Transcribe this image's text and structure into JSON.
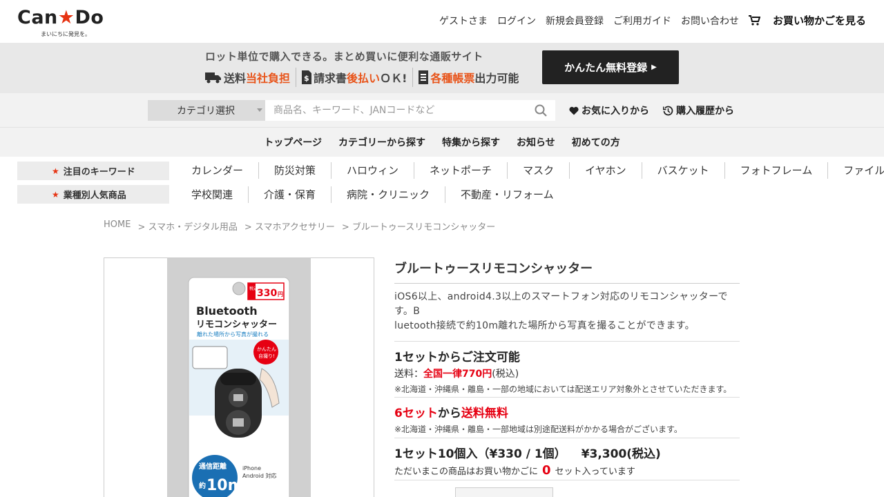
{
  "header": {
    "logo_text_a": "Can",
    "logo_star": "★",
    "logo_text_b": "Do",
    "logo_tagline": "まいにちに発見を。",
    "links": [
      "ゲストさま",
      "ログイン",
      "新規会員登録",
      "ご利用ガイド",
      "お問い合わせ"
    ],
    "cart_label": "お買い物かごを見る"
  },
  "promo": {
    "headline": "ロット単位で購入できる。まとめ買いに便利な通販サイト",
    "feat1_a": "送料",
    "feat1_b": "当社負担",
    "feat2_a": "請求書",
    "feat2_b": "後払い",
    "feat2_c": "ＯＫ!",
    "feat3_b": "各種帳票",
    "feat3_c": "出力可能",
    "register_label": "かんたん無料登録"
  },
  "search": {
    "category_label": "カテゴリ選択",
    "placeholder": "商品名、キーワード、JANコードなど",
    "favorites_label": "お気に入りから",
    "history_label": "購入履歴から"
  },
  "nav": [
    "トップページ",
    "カテゴリーから探す",
    "特集から探す",
    "お知らせ",
    "初めての方"
  ],
  "keywords": {
    "label": "注目のキーワード",
    "items": [
      "カレンダー",
      "防災対策",
      "ハロウィン",
      "ネットポーチ",
      "マスク",
      "イヤホン",
      "バスケット",
      "フォトフレーム",
      "ファイル"
    ]
  },
  "industry": {
    "label": "業種別人気商品",
    "items": [
      "学校関連",
      "介護・保育",
      "病院・クリニック",
      "不動産・リフォーム"
    ]
  },
  "breadcrumb": [
    "HOME",
    "> スマホ・デジタル用品",
    "> スマホアクセサリー",
    "> ブルートゥースリモコンシャッター"
  ],
  "product": {
    "title": "ブルートゥースリモコンシャッター",
    "desc_line1": "iOS6以上、android4.3以上のスマートフォン対応のリモコンシャッターで",
    "desc_line2": "す。B",
    "desc_line3": "luetooth接続で約10m離れた場所から写真を撮ることができます。",
    "min_order": "1セットからご注文可能",
    "ship_label": "送料：",
    "ship_value": "全国一律770円",
    "ship_tax": "(税込)",
    "ship_note": "※北海道・沖縄県・離島・一部の地域においては配送エリア対象外とさせていただきます。",
    "free_a": "6セット",
    "free_b": "から",
    "free_c": "送料無料",
    "free_note": "※北海道・沖縄県・離島・一部地域は別途配送料がかかる場合がございます。",
    "price_unit": "1セット10個入（¥330 / 1個）",
    "price_total": "¥3,300(税込)",
    "incart_a": "ただいまこの商品はお買い物かごに",
    "incart_count": "0",
    "incart_b": "セット入っています"
  },
  "package": {
    "price_tag": "330",
    "price_tag_small": "税込",
    "price_tag_unit": "円",
    "title_a": "Bluetooth",
    "title_b": "リモコンシャッター",
    "subtitle": "離れた場所から写真が撮れる",
    "bubble": "かんたん自撮り!",
    "dist_a": "通信距離",
    "dist_b": "約",
    "dist_c": "10m",
    "compat": "iPhone Android 対応"
  }
}
